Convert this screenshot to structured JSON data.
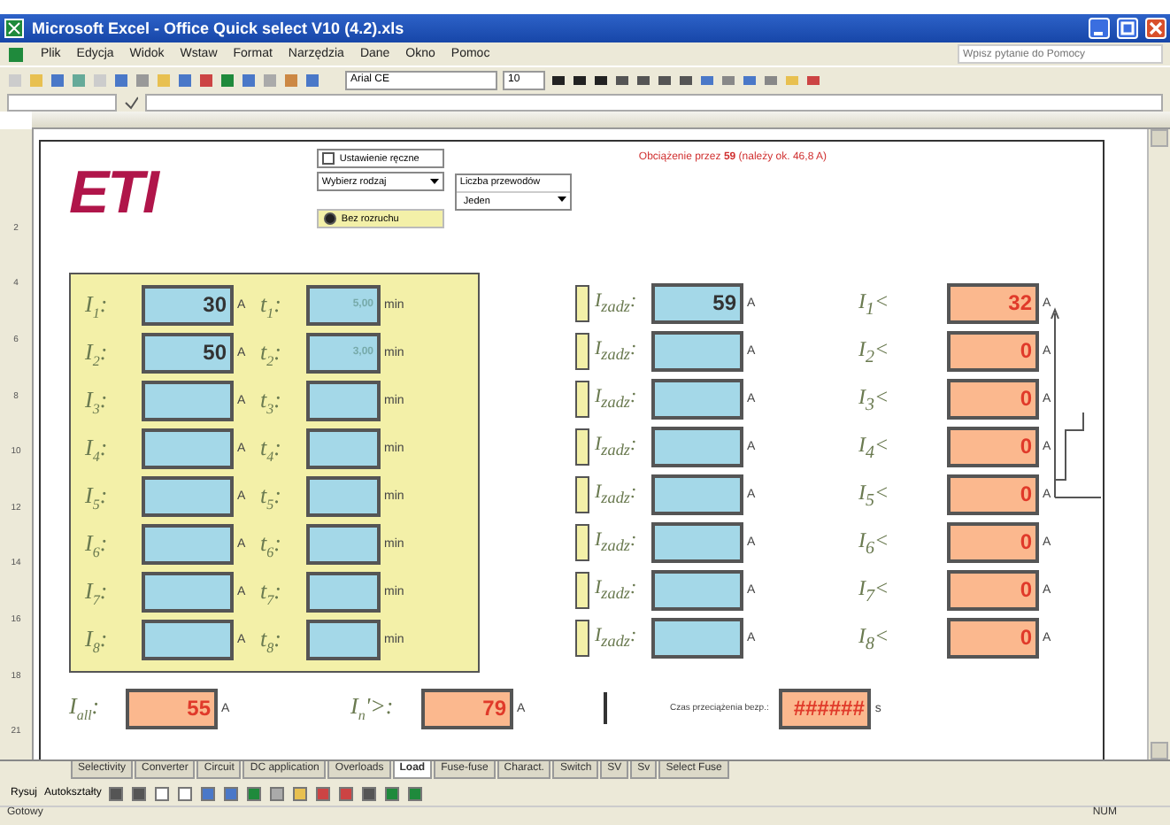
{
  "window": {
    "title": "Microsoft Excel - Office Quick select V10 (4.2).xls"
  },
  "menu": [
    "Plik",
    "Edycja",
    "Widok",
    "Wstaw",
    "Format",
    "Narzędzia",
    "Dane",
    "Okno",
    "Pomoc"
  ],
  "help_box": {
    "placeholder": "Wpisz pytanie do Pomocy"
  },
  "font": {
    "name": "Arial CE",
    "size": "10"
  },
  "row_numbers": [
    "2",
    "4",
    "6",
    "8",
    "10",
    "12",
    "14",
    "16",
    "18",
    "21"
  ],
  "logo": {
    "text": "ETI"
  },
  "options": {
    "checkbox": {
      "label": "Ustawienie ręczne",
      "checked": false
    },
    "dropdown1": {
      "value": "Wybierz rodzaj"
    },
    "radio": {
      "label": "Bez rozruchu",
      "selected": true
    },
    "dropdown2": {
      "label": "Liczba przewodów",
      "value": "Jeden"
    }
  },
  "callout": "Obciążenie przez **59** (należy ok. 46,8 A)",
  "loads": [
    {
      "label": "I$_{1}$:",
      "value": "30",
      "unit": "A",
      "time_label": "t$_{1}$:",
      "time": "5,00",
      "time_unit": "min"
    },
    {
      "label": "I$_{2}$:",
      "value": "50",
      "unit": "A",
      "time_label": "t$_{2}$:",
      "time": "3,00",
      "time_unit": "min"
    },
    {
      "label": "I$_{3}$:",
      "unit": "A",
      "time_label": "t$_{3}$:",
      "time_unit": "min"
    },
    {
      "label": "I$_{4}$:",
      "unit": "A",
      "time_label": "t$_{4}$:",
      "time_unit": "min"
    },
    {
      "label": "I$_{5}$:",
      "unit": "A",
      "time_label": "t$_{5}$:",
      "time_unit": "min"
    },
    {
      "label": "I$_{6}$:",
      "unit": "A",
      "time_label": "t$_{6}$:",
      "time_unit": "min"
    },
    {
      "label": "I$_{7}$:",
      "unit": "A",
      "time_label": "t$_{7}$:",
      "time_unit": "min"
    },
    {
      "label": "I$_{8}$:",
      "unit": "A",
      "time_label": "t$_{8}$:",
      "time_unit": "min"
    }
  ],
  "equivalent": [
    {
      "label": "I$_{zadz}$:",
      "value": "59",
      "unit": "A"
    },
    {
      "label": "I$_{zadz}$:",
      "unit": "A"
    },
    {
      "label": "I$_{zadz}$:",
      "unit": "A"
    },
    {
      "label": "I$_{zadz}$:",
      "unit": "A"
    },
    {
      "label": "I$_{zadz}$:",
      "unit": "A"
    },
    {
      "label": "I$_{zadz}$:",
      "unit": "A"
    },
    {
      "label": "I$_{zadz}$:",
      "unit": "A"
    },
    {
      "label": "I$_{zadz}$:",
      "unit": "A"
    }
  ],
  "limits": [
    {
      "label": "I$_{1}$<",
      "value": "32",
      "unit": "A"
    },
    {
      "label": "I$_{2}$<",
      "value": "0",
      "unit": "A"
    },
    {
      "label": "I$_{3}$<",
      "value": "0",
      "unit": "A"
    },
    {
      "label": "I$_{4}$<",
      "value": "0",
      "unit": "A"
    },
    {
      "label": "I$_{5}$<",
      "value": "0",
      "unit": "A"
    },
    {
      "label": "I$_{6}$<",
      "value": "0",
      "unit": "A"
    },
    {
      "label": "I$_{7}$<",
      "value": "0",
      "unit": "A"
    },
    {
      "label": "I$_{8}$<",
      "value": "0",
      "unit": "A"
    }
  ],
  "totals": [
    {
      "label": "I$_{all}$:",
      "value": "55",
      "unit": "A"
    },
    {
      "label": "I$_{n}$'>:",
      "value": "79",
      "unit": "A"
    },
    {
      "label": "Czas przeciążenia bezp.:",
      "value": "######",
      "unit": "s"
    }
  ],
  "sheet_tabs": [
    {
      "label": "Selectivity",
      "selected": false
    },
    {
      "label": "Converter",
      "selected": false
    },
    {
      "label": "Circuit",
      "selected": false
    },
    {
      "label": "DC application",
      "selected": false
    },
    {
      "label": "Overloads",
      "selected": false
    },
    {
      "label": "Load",
      "selected": true
    },
    {
      "label": "Fuse-fuse",
      "selected": false
    },
    {
      "label": "Charact.",
      "selected": false
    },
    {
      "label": "Switch",
      "selected": false
    },
    {
      "label": "SV",
      "selected": false
    },
    {
      "label": "Sv",
      "selected": false
    },
    {
      "label": "Select Fuse",
      "selected": false
    }
  ],
  "drawing_toolbar": {
    "draw": "Rysuj",
    "autoshapes": "Autokształty"
  },
  "status": {
    "left": "Gotowy",
    "right": "NUM"
  }
}
